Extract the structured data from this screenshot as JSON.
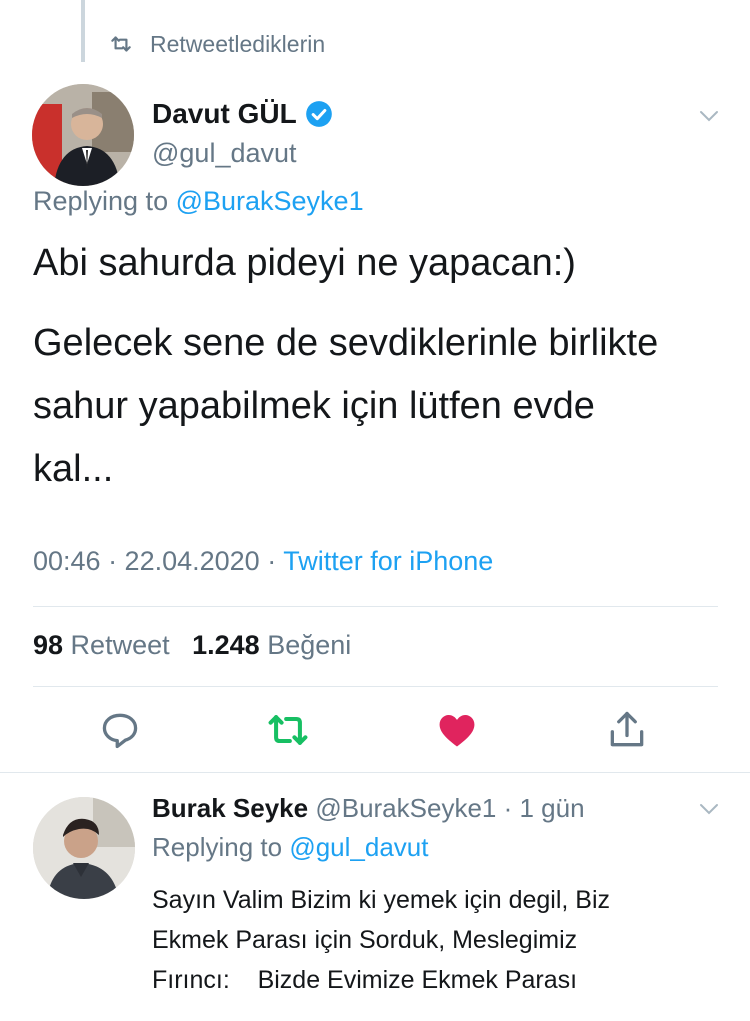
{
  "retweet_header": {
    "label": "Retweetlediklerin",
    "icon": "retweet-icon"
  },
  "tweet": {
    "author_name": "Davut GÜL",
    "author_handle": "@gul_davut",
    "replying_prefix": "Replying to ",
    "replying_to": "@BurakSeyke1",
    "text_line1": "Abi sahurda pideyi ne yapacan:)",
    "text_line2": "Gelecek sene de sevdiklerinle birlikte",
    "text_line3": "sahur yapabilmek için lütfen evde",
    "text_line4": "kal...",
    "time": "00:46 · 22.04.2020 · ",
    "source": "Twitter for iPhone",
    "retweet_count": "98",
    "retweet_label": " Retweet",
    "like_count": "1.248",
    "like_label": " Beğeni"
  },
  "actions": {
    "reply_icon": "reply-icon",
    "retweet_icon": "retweet-icon",
    "like_icon": "heart-icon",
    "share_icon": "share-icon",
    "retweet_color": "#17bf63",
    "like_color": "#e0245e"
  },
  "reply": {
    "author_name": "Burak Seyke",
    "author_handle": " @BurakSeyke1",
    "time": " · 1 gün",
    "replying_prefix": "Replying to ",
    "replying_to": "@gul_davut",
    "text_line1": "Sayın Valim Bizim ki yemek için degil, Biz",
    "text_line2": "Ekmek Parası için Sorduk, Meslegimiz",
    "text_line3": "Fırıncı:    Bizde Evimize Ekmek Parası"
  },
  "colors": {
    "accent": "#1da1f2",
    "muted": "#657786",
    "text": "#14171a"
  }
}
